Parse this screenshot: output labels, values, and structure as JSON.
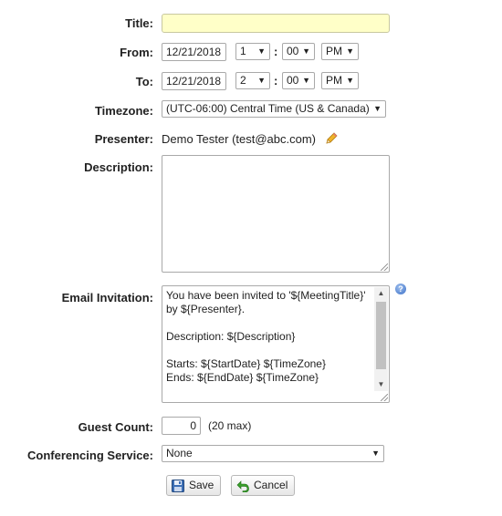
{
  "form": {
    "title": {
      "label": "Title:",
      "value": ""
    },
    "from": {
      "label": "From:",
      "date": "12/21/2018",
      "hour": "1",
      "minute": "00",
      "ampm": "PM"
    },
    "to": {
      "label": "To:",
      "date": "12/21/2018",
      "hour": "2",
      "minute": "00",
      "ampm": "PM"
    },
    "time_colon": ":",
    "timezone": {
      "label": "Timezone:",
      "value": "(UTC-06:00) Central Time (US & Canada)"
    },
    "presenter": {
      "label": "Presenter:",
      "value": "Demo Tester (test@abc.com)"
    },
    "description": {
      "label": "Description:",
      "value": ""
    },
    "email_invitation": {
      "label": "Email Invitation:",
      "value": "You have been invited to '${MeetingTitle}' by ${Presenter}.\n\nDescription: ${Description}\n\nStarts: ${StartDate} ${TimeZone}\nEnds: ${EndDate} ${TimeZone}\n\nTo join the web meeting, follow this link:"
    },
    "guest_count": {
      "label": "Guest Count:",
      "value": "0",
      "max_note": "(20 max)"
    },
    "conferencing_service": {
      "label": "Conferencing Service:",
      "value": "None"
    }
  },
  "buttons": {
    "save": "Save",
    "cancel": "Cancel"
  },
  "icons": {
    "edit": "pencil-icon",
    "help": "help-icon",
    "save": "floppy-disk-icon",
    "cancel": "undo-arrow-icon"
  },
  "colors": {
    "title_input_bg": "#ffffc8",
    "help_icon": "#3b6fc7",
    "cancel_icon": "#3aa02c"
  }
}
